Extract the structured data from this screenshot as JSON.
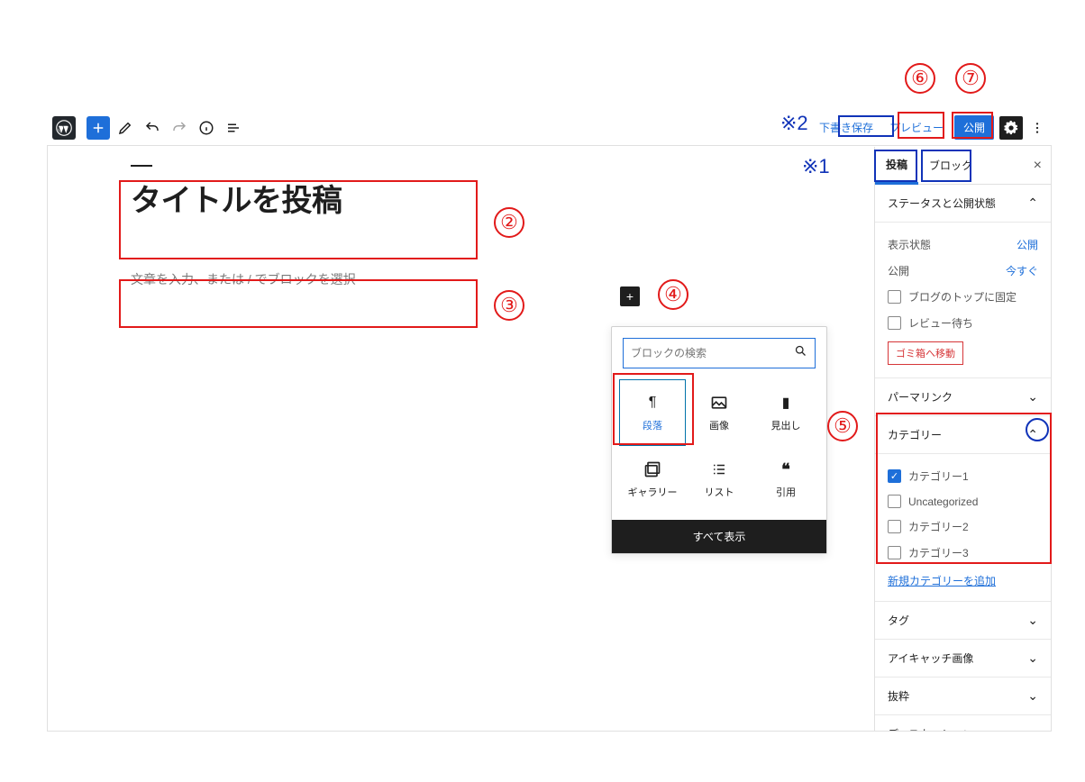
{
  "toolbar": {
    "save_draft": "下書き保存",
    "preview": "プレビュー",
    "publish": "公開"
  },
  "editor": {
    "title": "タイトルを投稿",
    "body_placeholder": "文章を入力、または / でブロックを選択"
  },
  "inserter": {
    "search_placeholder": "ブロックの検索",
    "blocks": [
      {
        "label": "段落",
        "icon": "paragraph"
      },
      {
        "label": "画像",
        "icon": "image"
      },
      {
        "label": "見出し",
        "icon": "heading"
      },
      {
        "label": "ギャラリー",
        "icon": "gallery"
      },
      {
        "label": "リスト",
        "icon": "list"
      },
      {
        "label": "引用",
        "icon": "quote"
      }
    ],
    "all_label": "すべて表示"
  },
  "sidebar": {
    "tabs": {
      "post": "投稿",
      "block": "ブロック"
    },
    "panels": {
      "status_title": "ステータスと公開状態",
      "visibility_label": "表示状態",
      "visibility_value": "公開",
      "publish_label": "公開",
      "publish_value": "今すぐ",
      "stick_label": "ブログのトップに固定",
      "review_label": "レビュー待ち",
      "trash_label": "ゴミ箱へ移動",
      "permalink_title": "パーマリンク",
      "categories_title": "カテゴリー",
      "categories": [
        {
          "label": "カテゴリー1",
          "checked": true
        },
        {
          "label": "Uncategorized",
          "checked": false
        },
        {
          "label": "カテゴリー2",
          "checked": false
        },
        {
          "label": "カテゴリー3",
          "checked": false
        }
      ],
      "add_category": "新規カテゴリーを追加",
      "tags_title": "タグ",
      "featured_title": "アイキャッチ画像",
      "excerpt_title": "抜粋",
      "discussion_title": "ディスカッション"
    }
  },
  "annotations": {
    "n2": "②",
    "n3": "③",
    "n4": "④",
    "n5": "⑤",
    "n6": "⑥",
    "n7": "⑦",
    "s1": "※1",
    "s2": "※2"
  }
}
